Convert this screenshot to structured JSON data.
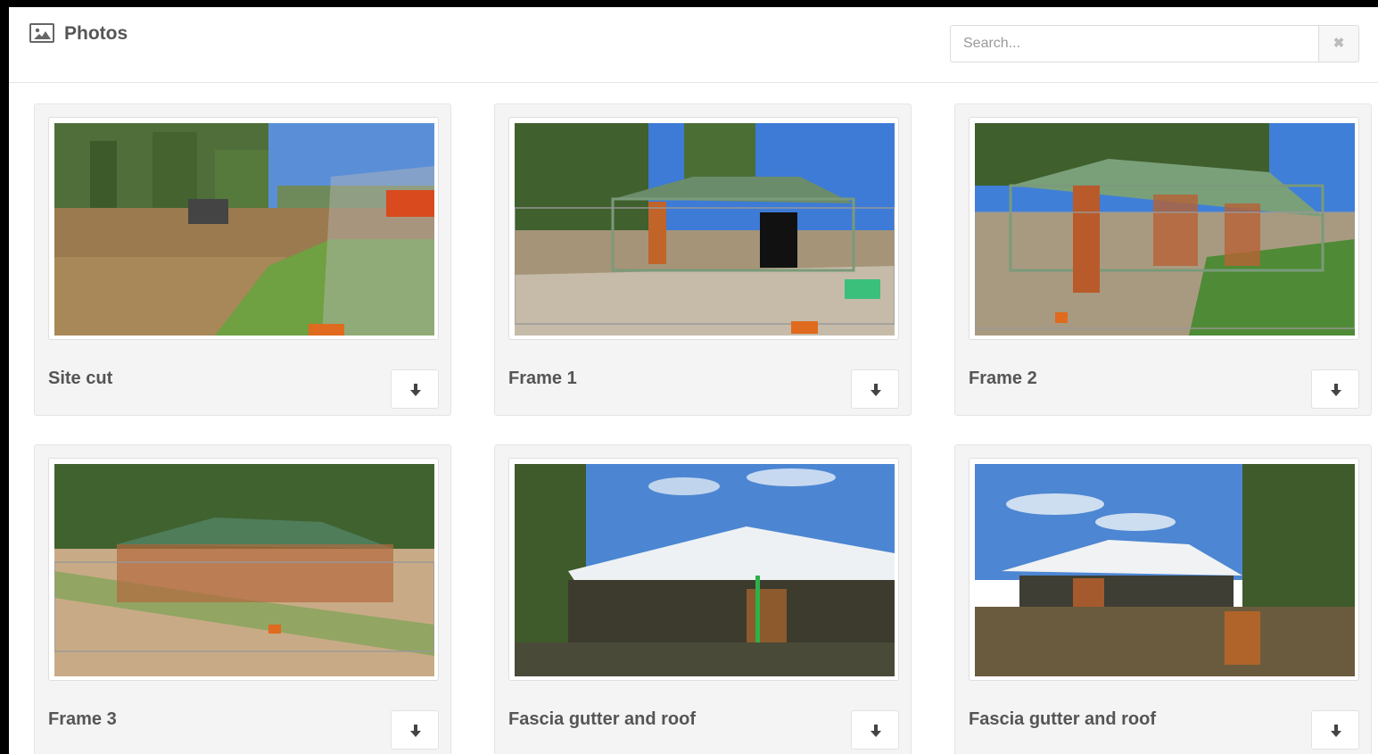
{
  "header": {
    "title": "Photos",
    "title_icon": "image-icon",
    "search": {
      "placeholder": "Search...",
      "value": "",
      "clear_icon": "close-icon"
    }
  },
  "gallery": {
    "photos": [
      {
        "caption": "Site cut",
        "scene": "site-cut"
      },
      {
        "caption": "Frame 1",
        "scene": "frame"
      },
      {
        "caption": "Frame 2",
        "scene": "frame"
      },
      {
        "caption": "Frame 3",
        "scene": "frame-roof"
      },
      {
        "caption": "Fascia gutter and roof",
        "scene": "roof"
      },
      {
        "caption": "Fascia gutter and roof",
        "scene": "roof"
      }
    ],
    "download_icon": "download-arrow-icon"
  }
}
